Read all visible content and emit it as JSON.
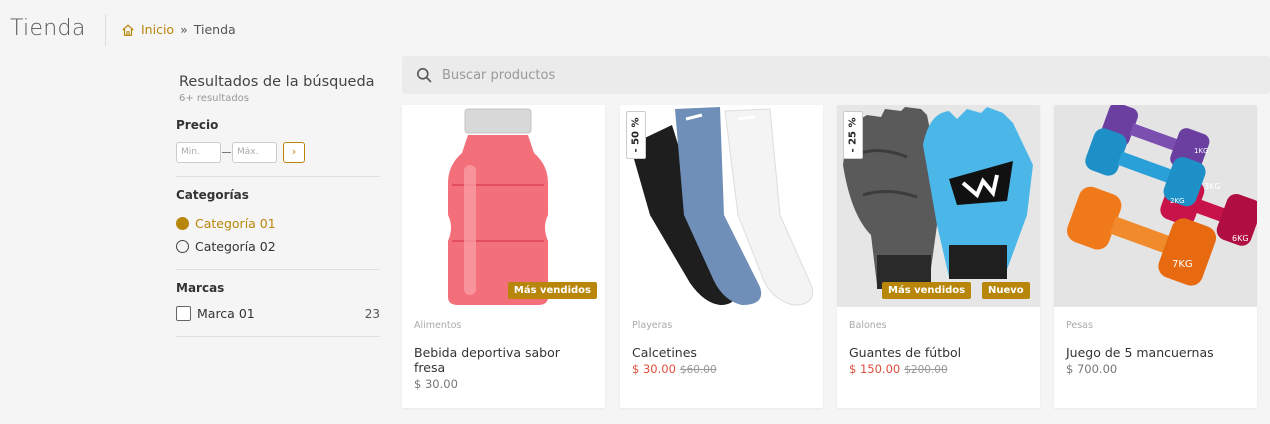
{
  "header": {
    "title": "Tienda",
    "breadcrumb": {
      "home": "Inicio",
      "separator": "»",
      "current": "Tienda"
    }
  },
  "sidebar": {
    "title": "Resultados de la búsqueda",
    "count": "6+ resultados",
    "price": {
      "heading": "Precio",
      "min_placeholder": "Min.",
      "max_placeholder": "Máx.",
      "go": "›"
    },
    "categories": {
      "heading": "Categorías",
      "items": [
        {
          "label": "Categoría 01",
          "selected": true
        },
        {
          "label": "Categoría 02",
          "selected": false
        }
      ]
    },
    "brands": {
      "heading": "Marcas",
      "items": [
        {
          "label": "Marca 01",
          "count": "23",
          "checked": false
        }
      ]
    }
  },
  "search": {
    "placeholder": "Buscar productos"
  },
  "accent_color": "#b8860b",
  "sale_color": "#e04d3d",
  "products": [
    {
      "category": "Alimentos",
      "name": "Bebida deportiva sabor fresa",
      "price": "$ 30.00",
      "badges": [
        "Más vendidos"
      ],
      "image": "red-sports-drink-bottle"
    },
    {
      "category": "Playeras",
      "name": "Calcetines",
      "price": "$ 30.00",
      "old_price": "$60.00",
      "discount": "- 50 %",
      "image": "socks"
    },
    {
      "category": "Balones",
      "name": "Guantes de fútbol",
      "price": "$ 150.00",
      "old_price": "$200.00",
      "discount": "- 25 %",
      "badges": [
        "Más vendidos",
        "Nuevo"
      ],
      "image": "goalkeeper-gloves"
    },
    {
      "category": "Pesas",
      "name": "Juego de 5 mancuernas",
      "price": "$ 700.00",
      "image": "dumbbells",
      "weights": [
        "1KG",
        "2KG",
        "3KG",
        "6KG",
        "7KG"
      ]
    }
  ]
}
